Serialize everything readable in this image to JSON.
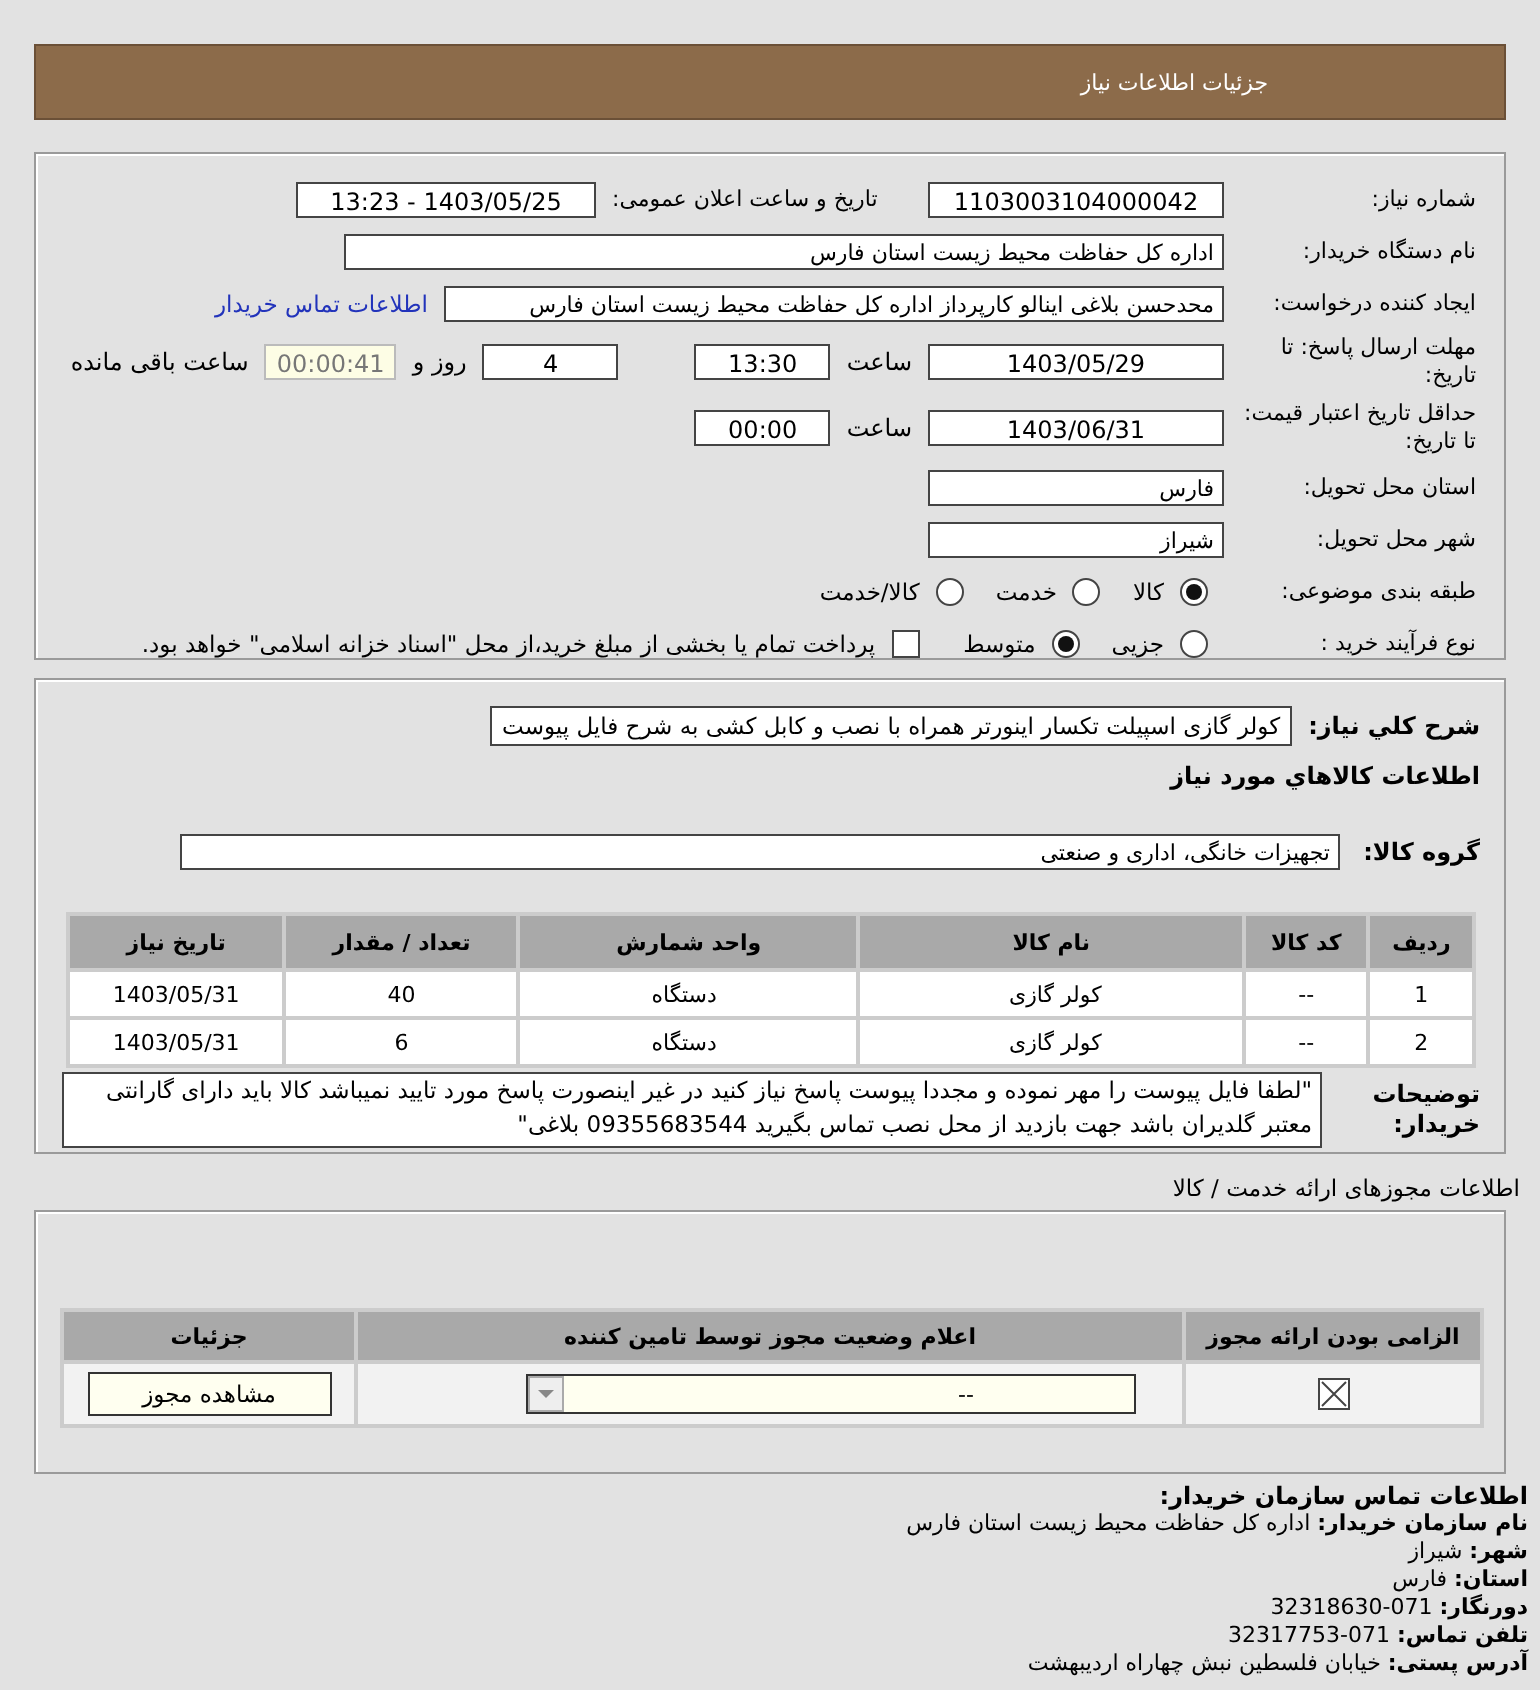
{
  "header": {
    "title": "جزئیات اطلاعات نیاز"
  },
  "need_number": {
    "label": "شماره نیاز:",
    "value": "1103003104000042"
  },
  "announce": {
    "label": "تاریخ و ساعت اعلان عمومی:",
    "value": "1403/05/25 - 13:23"
  },
  "buyer_org": {
    "label": "نام دستگاه خریدار:",
    "value": "اداره کل حفاظت محیط زیست استان فارس"
  },
  "creator": {
    "label": "ایجاد کننده درخواست:",
    "value": "محدحسن بلاغی اینالو کارپرداز اداره کل حفاظت محیط زیست استان فارس",
    "link": "اطلاعات تماس خریدار"
  },
  "deadline": {
    "label": "مهلت ارسال پاسخ: تا تاریخ:",
    "date": "1403/05/29",
    "time_label": "ساعت",
    "time": "13:30",
    "days": "4",
    "days_label": "روز و",
    "remaining": "00:00:41",
    "remaining_label": "ساعت باقی مانده"
  },
  "validity": {
    "label": "حداقل تاریخ اعتبار قیمت: تا تاریخ:",
    "date": "1403/06/31",
    "time_label": "ساعت",
    "time": "00:00"
  },
  "province": {
    "label": "استان محل تحویل:",
    "value": "فارس"
  },
  "city": {
    "label": "شهر محل تحویل:",
    "value": "شیراز"
  },
  "category": {
    "label": "طبقه بندی موضوعی:",
    "options": [
      {
        "label": "کالا",
        "selected": true
      },
      {
        "label": "خدمت",
        "selected": false
      },
      {
        "label": "کالا/خدمت",
        "selected": false
      }
    ]
  },
  "process": {
    "label": "نوع فرآیند خرید :",
    "options": [
      {
        "label": "جزیی",
        "selected": false
      },
      {
        "label": "متوسط",
        "selected": true
      }
    ],
    "treasury": {
      "checked": false,
      "label": "پرداخت تمام یا بخشی از مبلغ خرید،از محل \"اسناد خزانه اسلامی\" خواهد بود."
    }
  },
  "summary": {
    "label": "شرح کلي نياز:",
    "value": "کولر گازی اسپیلت تکسار اینورتر همراه با نصب و کابل کشی به شرح فایل پیوست"
  },
  "goods_heading": "اطلاعات کالاهاي مورد نياز",
  "goods_group": {
    "label": "گروه کالا:",
    "value": "تجهیزات خانگی، اداری و صنعتی"
  },
  "goods_table": {
    "columns": [
      "ردیف",
      "کد کالا",
      "نام کالا",
      "واحد شمارش",
      "تعداد / مقدار",
      "تاریخ نیاز"
    ],
    "rows": [
      [
        "1",
        "--",
        "کولر گازی",
        "دستگاه",
        "40",
        "1403/05/31"
      ],
      [
        "2",
        "--",
        "کولر گازی",
        "دستگاه",
        "6",
        "1403/05/31"
      ]
    ]
  },
  "buyer_notes": {
    "label": "توضیحات خریدار:",
    "value": "\"لطفا فایل پیوست را مهر نموده و مجددا پیوست پاسخ نیاز کنید در غیر اینصورت پاسخ مورد تایید نمیباشد کالا باید دارای گارانتی معتبر گلدیران باشد جهت بازدید از محل نصب تماس بگیرید 09355683544 بلاغی\""
  },
  "licenses_title": "اطلاعات مجوزهای ارائه خدمت / کالا",
  "licenses_table": {
    "columns": [
      "الزامی بودن ارائه مجوز",
      "اعلام وضعیت مجوز توسط تامین کننده",
      "جزئیات"
    ],
    "rows": [
      {
        "required": true,
        "status": "--",
        "button": "مشاهده مجوز"
      }
    ]
  },
  "contact": {
    "title": "اطلاعات تماس سازمان خریدار:",
    "lines": [
      {
        "label": "نام سازمان خریدار:",
        "value": "اداره کل حفاظت محیط زیست استان فارس"
      },
      {
        "label": "شهر:",
        "value": "شیراز"
      },
      {
        "label": "استان:",
        "value": "فارس"
      },
      {
        "label": "دورنگار:",
        "value": "071-32318630"
      },
      {
        "label": "تلفن تماس:",
        "value": "071-32317753"
      },
      {
        "label": "آدرس پستی:",
        "value": "خیابان فلسطین نبش چهاراه اردیبهشت"
      }
    ]
  }
}
